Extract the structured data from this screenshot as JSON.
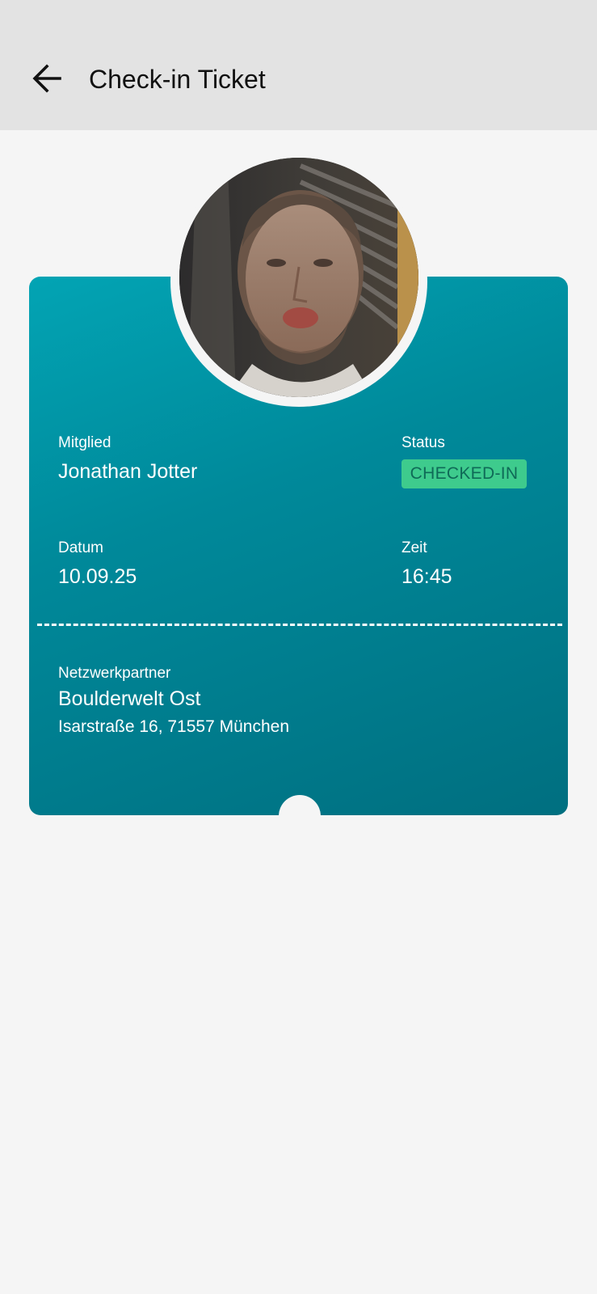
{
  "header": {
    "title": "Check-in Ticket"
  },
  "icons": {
    "back": "arrow-left-icon",
    "photo": "member-photo"
  },
  "colors": {
    "app_bar": "#e3e3e3",
    "background": "#f5f5f5",
    "ticket_gradient_start": "#02a4b4",
    "ticket_gradient_end": "#006f80",
    "status_badge_bg": "#3ecb8d",
    "status_badge_text": "#0f6a57"
  },
  "ticket": {
    "member_label": "Mitglied",
    "member_name": "Jonathan Jotter",
    "status_label": "Status",
    "status_value": "CHECKED-IN",
    "date_label": "Datum",
    "date_value": "10.09.25",
    "time_label": "Zeit",
    "time_value": "16:45",
    "partner_label": "Netzwerkpartner",
    "partner_name": "Boulderwelt Ost",
    "partner_address": "Isarstraße 16, 71557 München"
  }
}
